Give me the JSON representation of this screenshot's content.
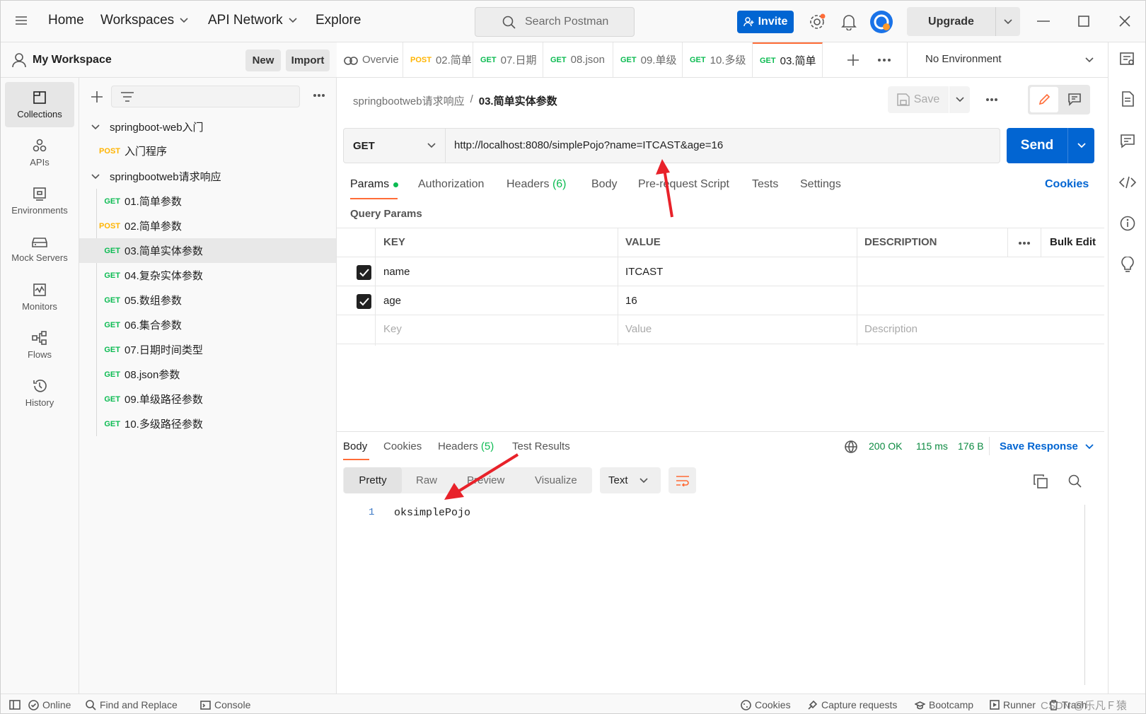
{
  "topnav": {
    "home": "Home",
    "workspaces": "Workspaces",
    "api_network": "API Network",
    "explore": "Explore",
    "search_placeholder": "Search Postman",
    "invite": "Invite",
    "upgrade": "Upgrade"
  },
  "workspace": {
    "name": "My Workspace",
    "new": "New",
    "import": "Import"
  },
  "tabs": [
    {
      "method": "",
      "label": "Overvie"
    },
    {
      "method": "POST",
      "label": "02.简单"
    },
    {
      "method": "GET",
      "label": "07.日期"
    },
    {
      "method": "GET",
      "label": "08.json"
    },
    {
      "method": "GET",
      "label": "09.单级"
    },
    {
      "method": "GET",
      "label": "10.多级"
    },
    {
      "method": "GET",
      "label": "03.简单"
    }
  ],
  "environment": "No Environment",
  "rail": [
    "Collections",
    "APIs",
    "Environments",
    "Mock Servers",
    "Monitors",
    "Flows",
    "History"
  ],
  "tree": {
    "col1": "springboot-web入门",
    "col1_items": [
      {
        "method": "POST",
        "label": "入门程序"
      }
    ],
    "col2": "springbootweb请求响应",
    "col2_items": [
      {
        "method": "GET",
        "label": "01.简单参数"
      },
      {
        "method": "POST",
        "label": "02.简单参数"
      },
      {
        "method": "GET",
        "label": "03.简单实体参数"
      },
      {
        "method": "GET",
        "label": "04.复杂实体参数"
      },
      {
        "method": "GET",
        "label": "05.数组参数"
      },
      {
        "method": "GET",
        "label": "06.集合参数"
      },
      {
        "method": "GET",
        "label": "07.日期时间类型"
      },
      {
        "method": "GET",
        "label": "08.json参数"
      },
      {
        "method": "GET",
        "label": "09.单级路径参数"
      },
      {
        "method": "GET",
        "label": "10.多级路径参数"
      }
    ]
  },
  "breadcrumb": {
    "parent": "springbootweb请求响应",
    "sep": "/",
    "current": "03.简单实体参数"
  },
  "save": "Save",
  "request": {
    "method": "GET",
    "url": "http://localhost:8080/simplePojo?name=ITCAST&age=16",
    "send": "Send"
  },
  "req_tabs": {
    "params": "Params",
    "authorization": "Authorization",
    "headers": "Headers",
    "headers_count": "(6)",
    "body": "Body",
    "prerequest": "Pre-request Script",
    "tests": "Tests",
    "settings": "Settings",
    "cookies": "Cookies"
  },
  "query_params_title": "Query Params",
  "params_table": {
    "headers": {
      "key": "KEY",
      "value": "VALUE",
      "description": "DESCRIPTION",
      "bulk": "Bulk Edit"
    },
    "rows": [
      {
        "key": "name",
        "value": "ITCAST",
        "checked": true
      },
      {
        "key": "age",
        "value": "16",
        "checked": true
      }
    ],
    "placeholder": {
      "key": "Key",
      "value": "Value",
      "description": "Description"
    }
  },
  "response": {
    "tabs": {
      "body": "Body",
      "cookies": "Cookies",
      "headers": "Headers",
      "headers_count": "(5)",
      "test_results": "Test Results"
    },
    "status": "200 OK",
    "time": "115 ms",
    "size": "176 B",
    "save_response": "Save Response",
    "view_tabs": [
      "Pretty",
      "Raw",
      "Preview",
      "Visualize"
    ],
    "format": "Text",
    "line_no": "1",
    "body_text": "oksimplePojo"
  },
  "statusbar": {
    "online": "Online",
    "find_replace": "Find and Replace",
    "console": "Console",
    "cookies": "Cookies",
    "capture": "Capture requests",
    "bootcamp": "Bootcamp",
    "runner": "Runner",
    "trash": "Trash",
    "watermark": "CSDN @乐凡Ｆ猿"
  },
  "colors": {
    "accent": "#0265d2",
    "get": "#0cbb52",
    "post": "#ffb400",
    "active_tab": "#ff6c37",
    "arrow": "#e8222a"
  }
}
